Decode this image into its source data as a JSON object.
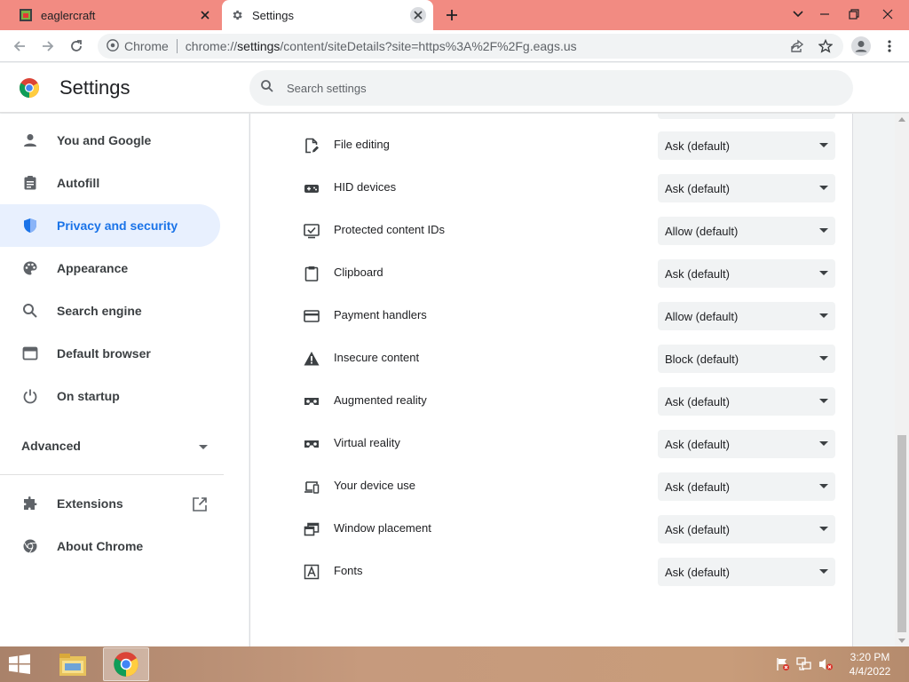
{
  "tabs": [
    {
      "title": "eaglercraft",
      "favicon": "eaglercraft-favicon-icon"
    },
    {
      "title": "Settings",
      "favicon": "gear-icon"
    }
  ],
  "omnibox": {
    "site_chip": "Chrome",
    "url_prefix": "chrome://",
    "url_host": "settings",
    "url_rest": "/content/siteDetails?site=https%3A%2F%2Fg.eags.us"
  },
  "header": {
    "title": "Settings",
    "search_placeholder": "Search settings"
  },
  "sidebar": {
    "items": [
      {
        "label": "You and Google",
        "icon": "person-icon"
      },
      {
        "label": "Autofill",
        "icon": "clipboard-icon"
      },
      {
        "label": "Privacy and security",
        "icon": "shield-icon",
        "active": true
      },
      {
        "label": "Appearance",
        "icon": "palette-icon"
      },
      {
        "label": "Search engine",
        "icon": "search-icon"
      },
      {
        "label": "Default browser",
        "icon": "browser-window-icon"
      },
      {
        "label": "On startup",
        "icon": "power-icon"
      }
    ],
    "advanced": "Advanced",
    "extensions": "Extensions",
    "about": "About Chrome"
  },
  "permissions": [
    {
      "label": "File editing",
      "value": "Ask (default)",
      "icon": "file-edit-icon"
    },
    {
      "label": "HID devices",
      "value": "Ask (default)",
      "icon": "gamepad-icon"
    },
    {
      "label": "Protected content IDs",
      "value": "Allow (default)",
      "icon": "monitor-check-icon"
    },
    {
      "label": "Clipboard",
      "value": "Ask (default)",
      "icon": "clipboard-icon"
    },
    {
      "label": "Payment handlers",
      "value": "Allow (default)",
      "icon": "credit-card-icon"
    },
    {
      "label": "Insecure content",
      "value": "Block (default)",
      "icon": "warning-icon"
    },
    {
      "label": "Augmented reality",
      "value": "Ask (default)",
      "icon": "vr-headset-icon"
    },
    {
      "label": "Virtual reality",
      "value": "Ask (default)",
      "icon": "vr-headset-icon"
    },
    {
      "label": "Your device use",
      "value": "Ask (default)",
      "icon": "devices-icon"
    },
    {
      "label": "Window placement",
      "value": "Ask (default)",
      "icon": "window-placement-icon"
    },
    {
      "label": "Fonts",
      "value": "Ask (default)",
      "icon": "font-icon"
    }
  ],
  "taskbar": {
    "time": "3:20 PM",
    "date": "4/4/2022"
  },
  "colors": {
    "tabstrip": "#f28b82",
    "accent": "#1a73e8",
    "active_nav_bg": "#e8f0fe"
  }
}
